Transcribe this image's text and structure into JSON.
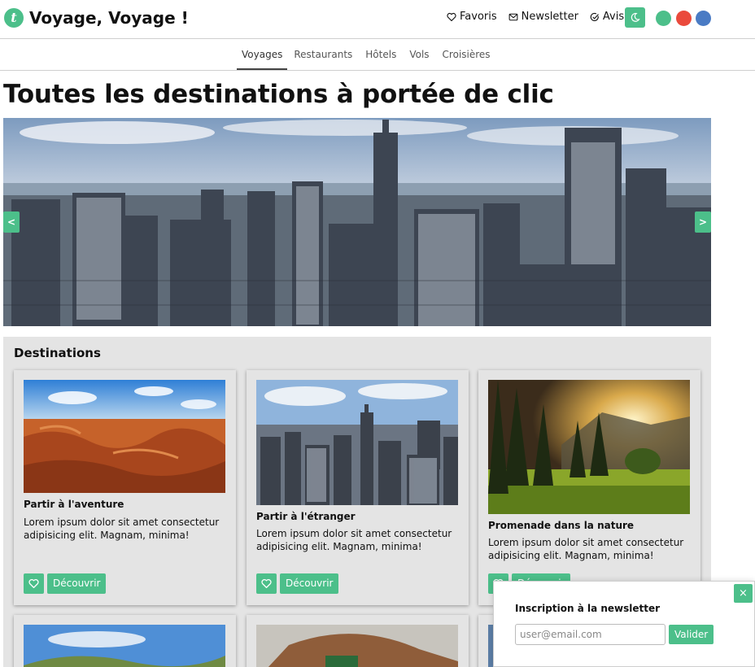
{
  "header": {
    "brand": "Voyage, Voyage !",
    "logo_letter": "t",
    "nav": [
      {
        "label": "Favoris",
        "icon": "heart-icon"
      },
      {
        "label": "Newsletter",
        "icon": "envelope-icon"
      },
      {
        "label": "Avis",
        "icon": "check-circle-icon"
      }
    ],
    "theme_button_icon": "moon-icon",
    "theme_colors": [
      "#4cbf8a",
      "#ea4a3c",
      "#4a7bc4"
    ]
  },
  "categories": [
    {
      "label": "Voyages",
      "active": true
    },
    {
      "label": "Restaurants"
    },
    {
      "label": "Hôtels"
    },
    {
      "label": "Vols"
    },
    {
      "label": "Croisières"
    }
  ],
  "page_title": "Toutes les destinations à portée de clic",
  "carousel": {
    "prev_label": "<",
    "next_label": ">"
  },
  "destinations": {
    "title": "Destinations",
    "cards": [
      {
        "title": "Partir à l'aventure",
        "text": "Lorem ipsum dolor sit amet consectetur adipisicing elit. Magnam, minima!",
        "button": "Découvrir"
      },
      {
        "title": "Partir à l'étranger",
        "text": "Lorem ipsum dolor sit amet consectetur adipisicing elit. Magnam, minima!",
        "button": "Découvrir"
      },
      {
        "title": "Promenade dans la nature",
        "text": "Lorem ipsum dolor sit amet consectetur adipisicing elit. Magnam, minima!",
        "button": "Découvrir"
      }
    ]
  },
  "newsletter": {
    "title": "Inscription à la newsletter",
    "placeholder": "user@email.com",
    "submit": "Valider",
    "close": "×"
  },
  "colors": {
    "accent": "#4cbf8a",
    "panel": "#e4e4e4"
  }
}
